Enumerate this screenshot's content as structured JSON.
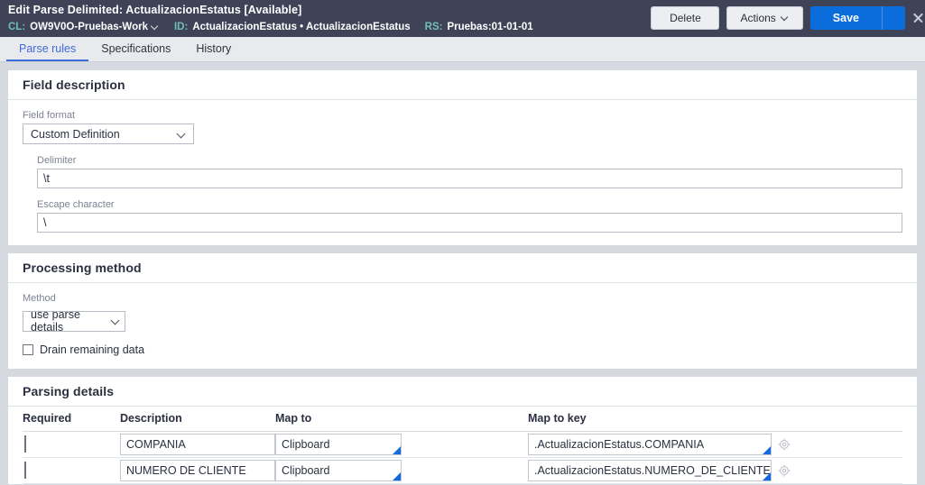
{
  "header": {
    "title_prefix": "Edit",
    "title_type": "Parse Delimited:",
    "title_name": "ActualizacionEstatus",
    "title_status": "[Available]",
    "title_full": "Edit  Parse Delimited: ActualizacionEstatus [Available]",
    "meta": [
      {
        "key": "CL:",
        "value": "OW9V0O-Pruebas-Work",
        "has_chevron": true
      },
      {
        "key": "ID:",
        "value": "ActualizacionEstatus • ActualizacionEstatus",
        "has_chevron": false
      },
      {
        "key": "RS:",
        "value": "Pruebas:01-01-01",
        "has_chevron": false
      }
    ],
    "buttons": {
      "delete": "Delete",
      "actions": "Actions",
      "save": "Save"
    },
    "icons": {
      "actions_caret": "chevron-down-icon",
      "save_caret": "chevron-down-icon",
      "close": "close-icon"
    },
    "colors": {
      "bar_bg": "#3f4357",
      "meta_key": "#6fbfb6",
      "save_blue": "#0b6ddb"
    }
  },
  "tabs": [
    {
      "label": "Parse rules",
      "active": true
    },
    {
      "label": "Specifications",
      "active": false
    },
    {
      "label": "History",
      "active": false
    }
  ],
  "field_description": {
    "section_title": "Field description",
    "field_format_label": "Field format",
    "field_format_value": "Custom Definition",
    "delimiter_label": "Delimiter",
    "delimiter_value": "\\t",
    "escape_label": "Escape character",
    "escape_value": "\\"
  },
  "processing_method": {
    "section_title": "Processing method",
    "method_label": "Method",
    "method_value": "use parse details",
    "drain_label": "Drain remaining data",
    "drain_checked": false
  },
  "parsing_details": {
    "section_title": "Parsing details",
    "columns": [
      "Required",
      "Description",
      "Map to",
      "Map to key"
    ],
    "rows": [
      {
        "required": false,
        "description": "COMPANIA",
        "map_to": "Clipboard",
        "map_to_key": ".ActualizacionEstatus.COMPANIA",
        "gear_icon": "target-gear-icon"
      },
      {
        "required": false,
        "description": "NUMERO DE CLIENTE",
        "map_to": "Clipboard",
        "map_to_key": ".ActualizacionEstatus.NUMERO_DE_CLIENTE",
        "gear_icon": "target-gear-icon"
      }
    ]
  }
}
